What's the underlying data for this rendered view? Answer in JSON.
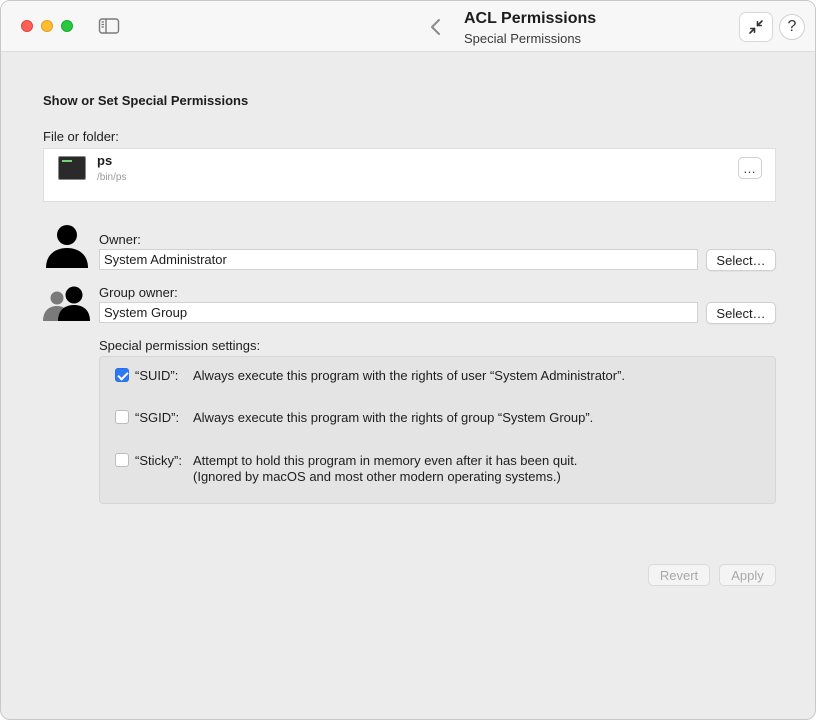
{
  "window": {
    "title": "ACL Permissions",
    "subtitle": "Special Permissions"
  },
  "toolbar": {
    "help_label": "?"
  },
  "main": {
    "heading": "Show or Set Special Permissions",
    "file_label": "File or folder:",
    "file": {
      "name": "ps",
      "path": "/bin/ps",
      "more_label": "…"
    },
    "owner": {
      "label": "Owner:",
      "value": "System Administrator",
      "select_label": "Select…"
    },
    "group": {
      "label": "Group owner:",
      "value": "System Group",
      "select_label": "Select…"
    },
    "settings_label": "Special permission settings:",
    "options": [
      {
        "key": "“SUID”:",
        "description": "Always execute this program with the rights of user “System Administrator”.",
        "checked": true
      },
      {
        "key": "“SGID”:",
        "description": "Always execute this program with the rights of group “System Group”.",
        "checked": false
      },
      {
        "key": "“Sticky”:",
        "description": "Attempt to hold this program in memory even after it has been quit.",
        "description_line2": "(Ignored by macOS and most other modern operating systems.)",
        "checked": false
      }
    ],
    "revert_label": "Revert",
    "apply_label": "Apply"
  },
  "colors": {
    "accent": "#2d79f5",
    "close": "#fe5f57",
    "minimize": "#febc2e",
    "maximize": "#28c840"
  },
  "icons": {
    "sidebar": "sidebar-icon",
    "back": "chevron-left-icon",
    "collapse": "collapse-arrows-icon",
    "owner": "person-icon",
    "group": "group-icon",
    "file": "terminal-executable-icon"
  }
}
